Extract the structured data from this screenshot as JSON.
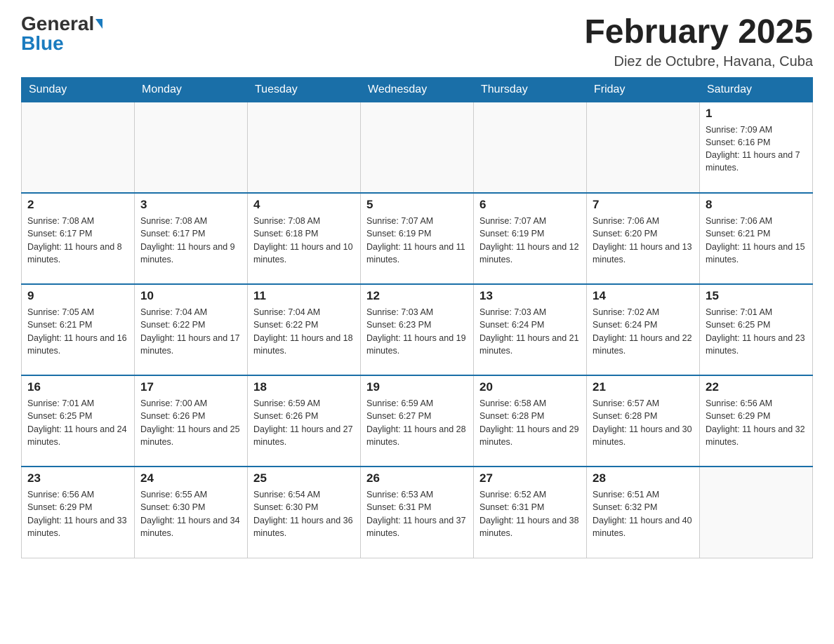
{
  "header": {
    "logo_general": "General",
    "logo_blue": "Blue",
    "title": "February 2025",
    "subtitle": "Diez de Octubre, Havana, Cuba"
  },
  "days_of_week": [
    "Sunday",
    "Monday",
    "Tuesday",
    "Wednesday",
    "Thursday",
    "Friday",
    "Saturday"
  ],
  "weeks": [
    [
      {
        "day": "",
        "info": ""
      },
      {
        "day": "",
        "info": ""
      },
      {
        "day": "",
        "info": ""
      },
      {
        "day": "",
        "info": ""
      },
      {
        "day": "",
        "info": ""
      },
      {
        "day": "",
        "info": ""
      },
      {
        "day": "1",
        "info": "Sunrise: 7:09 AM\nSunset: 6:16 PM\nDaylight: 11 hours and 7 minutes."
      }
    ],
    [
      {
        "day": "2",
        "info": "Sunrise: 7:08 AM\nSunset: 6:17 PM\nDaylight: 11 hours and 8 minutes."
      },
      {
        "day": "3",
        "info": "Sunrise: 7:08 AM\nSunset: 6:17 PM\nDaylight: 11 hours and 9 minutes."
      },
      {
        "day": "4",
        "info": "Sunrise: 7:08 AM\nSunset: 6:18 PM\nDaylight: 11 hours and 10 minutes."
      },
      {
        "day": "5",
        "info": "Sunrise: 7:07 AM\nSunset: 6:19 PM\nDaylight: 11 hours and 11 minutes."
      },
      {
        "day": "6",
        "info": "Sunrise: 7:07 AM\nSunset: 6:19 PM\nDaylight: 11 hours and 12 minutes."
      },
      {
        "day": "7",
        "info": "Sunrise: 7:06 AM\nSunset: 6:20 PM\nDaylight: 11 hours and 13 minutes."
      },
      {
        "day": "8",
        "info": "Sunrise: 7:06 AM\nSunset: 6:21 PM\nDaylight: 11 hours and 15 minutes."
      }
    ],
    [
      {
        "day": "9",
        "info": "Sunrise: 7:05 AM\nSunset: 6:21 PM\nDaylight: 11 hours and 16 minutes."
      },
      {
        "day": "10",
        "info": "Sunrise: 7:04 AM\nSunset: 6:22 PM\nDaylight: 11 hours and 17 minutes."
      },
      {
        "day": "11",
        "info": "Sunrise: 7:04 AM\nSunset: 6:22 PM\nDaylight: 11 hours and 18 minutes."
      },
      {
        "day": "12",
        "info": "Sunrise: 7:03 AM\nSunset: 6:23 PM\nDaylight: 11 hours and 19 minutes."
      },
      {
        "day": "13",
        "info": "Sunrise: 7:03 AM\nSunset: 6:24 PM\nDaylight: 11 hours and 21 minutes."
      },
      {
        "day": "14",
        "info": "Sunrise: 7:02 AM\nSunset: 6:24 PM\nDaylight: 11 hours and 22 minutes."
      },
      {
        "day": "15",
        "info": "Sunrise: 7:01 AM\nSunset: 6:25 PM\nDaylight: 11 hours and 23 minutes."
      }
    ],
    [
      {
        "day": "16",
        "info": "Sunrise: 7:01 AM\nSunset: 6:25 PM\nDaylight: 11 hours and 24 minutes."
      },
      {
        "day": "17",
        "info": "Sunrise: 7:00 AM\nSunset: 6:26 PM\nDaylight: 11 hours and 25 minutes."
      },
      {
        "day": "18",
        "info": "Sunrise: 6:59 AM\nSunset: 6:26 PM\nDaylight: 11 hours and 27 minutes."
      },
      {
        "day": "19",
        "info": "Sunrise: 6:59 AM\nSunset: 6:27 PM\nDaylight: 11 hours and 28 minutes."
      },
      {
        "day": "20",
        "info": "Sunrise: 6:58 AM\nSunset: 6:28 PM\nDaylight: 11 hours and 29 minutes."
      },
      {
        "day": "21",
        "info": "Sunrise: 6:57 AM\nSunset: 6:28 PM\nDaylight: 11 hours and 30 minutes."
      },
      {
        "day": "22",
        "info": "Sunrise: 6:56 AM\nSunset: 6:29 PM\nDaylight: 11 hours and 32 minutes."
      }
    ],
    [
      {
        "day": "23",
        "info": "Sunrise: 6:56 AM\nSunset: 6:29 PM\nDaylight: 11 hours and 33 minutes."
      },
      {
        "day": "24",
        "info": "Sunrise: 6:55 AM\nSunset: 6:30 PM\nDaylight: 11 hours and 34 minutes."
      },
      {
        "day": "25",
        "info": "Sunrise: 6:54 AM\nSunset: 6:30 PM\nDaylight: 11 hours and 36 minutes."
      },
      {
        "day": "26",
        "info": "Sunrise: 6:53 AM\nSunset: 6:31 PM\nDaylight: 11 hours and 37 minutes."
      },
      {
        "day": "27",
        "info": "Sunrise: 6:52 AM\nSunset: 6:31 PM\nDaylight: 11 hours and 38 minutes."
      },
      {
        "day": "28",
        "info": "Sunrise: 6:51 AM\nSunset: 6:32 PM\nDaylight: 11 hours and 40 minutes."
      },
      {
        "day": "",
        "info": ""
      }
    ]
  ]
}
